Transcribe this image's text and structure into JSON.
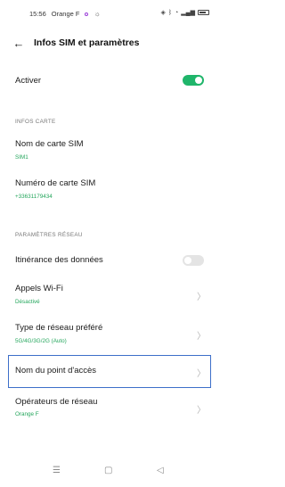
{
  "status_bar": {
    "time": "15:56",
    "carrier": "Orange F"
  },
  "header": {
    "title": "Infos SIM et paramètres"
  },
  "activate": {
    "label": "Activer",
    "enabled": true
  },
  "card_section": {
    "header": "INFOS CARTE",
    "sim_name_label": "Nom de carte SIM",
    "sim_name_value": "SIM1",
    "sim_number_label": "Numéro de carte SIM",
    "sim_number_value": "+33631179434"
  },
  "network_section": {
    "header": "PARAMÈTRES RÉSEAU",
    "roaming_label": "Itinérance des données",
    "roaming_enabled": false,
    "wifi_calls_label": "Appels Wi-Fi",
    "wifi_calls_value": "Désactivé",
    "network_type_label": "Type de réseau préféré",
    "network_type_value": "5G/4G/3G/2G (Auto)",
    "apn_label": "Nom du point d'accès",
    "operators_label": "Opérateurs de réseau",
    "operators_value": "Orange F"
  },
  "colors": {
    "accent_green": "#1fb56a",
    "highlight_blue": "#3d6fc9"
  }
}
